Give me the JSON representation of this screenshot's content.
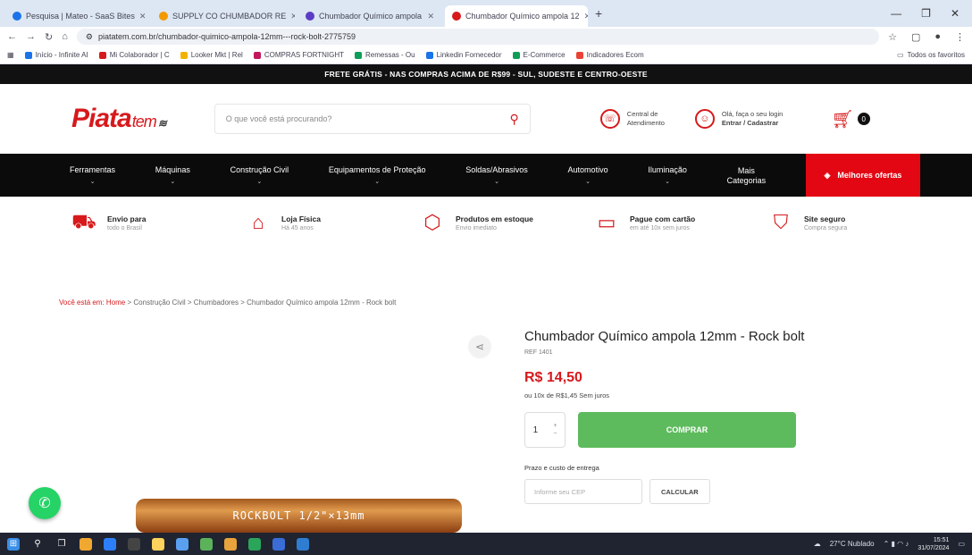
{
  "browser": {
    "tabs": [
      {
        "label": "Pesquisa | Mateo - SaaS Bites",
        "color": "#1a73e8"
      },
      {
        "label": "SUPPLY CO CHUMBADOR RE",
        "color": "#f29900"
      },
      {
        "label": "Chumbador Químico ampola",
        "color": "#5b3cc4"
      },
      {
        "label": "Chumbador Químico ampola 12",
        "color": "#d7191c"
      }
    ],
    "new_tab": "+",
    "url": "piatatem.com.br/chumbador-quimico-ampola-12mm---rock-bolt-2775759",
    "bookmarks": [
      {
        "label": "Início - Infinite AI",
        "color": "#1a73e8"
      },
      {
        "label": "Mi Colaborador | C",
        "color": "#d7191c"
      },
      {
        "label": "Looker Mkt | Rel",
        "color": "#f2b300"
      },
      {
        "label": "COMPRAS FORTNIGHT",
        "color": "#c2185b"
      },
      {
        "label": "Remessas - Ou",
        "color": "#0f9d58"
      },
      {
        "label": "Linkedin Fornecedor",
        "color": "#1a73e8"
      },
      {
        "label": "E-Commerce",
        "color": "#0f9d58"
      },
      {
        "label": "Indicadores Ecom",
        "color": "#ea4335"
      }
    ],
    "bookmarks_right": "Todos os favoritos"
  },
  "promo_bar": "FRETE GRÁTIS - NAS COMPRAS ACIMA DE R$99 - SUL, SUDESTE E CENTRO-OESTE",
  "header": {
    "logo_main": "Piata",
    "logo_sub": "tem",
    "search_placeholder": "O que você está procurando?",
    "service": {
      "line1": "Central de",
      "line2": "Atendimento"
    },
    "account": {
      "line1": "Olá, faça o seu login",
      "line2": "Entrar / Cadastrar"
    },
    "cart_count": "0"
  },
  "nav": {
    "items": [
      "Ferramentas",
      "Máquinas",
      "Construção Civil",
      "Equipamentos de Proteção",
      "Soldas/Abrasivos",
      "Automotivo",
      "Iluminação"
    ],
    "more": {
      "line1": "Mais",
      "line2": "Categorias"
    },
    "offers": "Melhores ofertas"
  },
  "benefits": [
    {
      "title": "Envio para",
      "subtitle": "todo o Brasil",
      "icon": "truck-icon"
    },
    {
      "title": "Loja Física",
      "subtitle": "Há 45 anos",
      "icon": "store-icon"
    },
    {
      "title": "Produtos em estoque",
      "subtitle": "Envio imediato",
      "icon": "box-icon"
    },
    {
      "title": "Pague com cartão",
      "subtitle": "em até 10x sem juros",
      "icon": "card-icon"
    },
    {
      "title": "Site seguro",
      "subtitle": "Compra segura",
      "icon": "shield-icon"
    }
  ],
  "breadcrumb": {
    "home": "Você está em: Home",
    "trail": "> Construção Civil > Chumbadores > Chumbador Químico ampola 12mm - Rock bolt"
  },
  "product": {
    "title": "Chumbador Químico ampola 12mm - Rock bolt",
    "sku": "REF 1401",
    "price": "R$ 14,50",
    "installment": "ou 10x de R$1,45 Sem juros",
    "qty": "1",
    "buy_label": "COMPRAR",
    "shipping_label": "Prazo e custo de entrega",
    "cep_placeholder": "Informe seu CEP",
    "calc_label": "CALCULAR",
    "image_text": "ROCKBOLT 1/2\"×13mm"
  },
  "taskbar": {
    "weather": "27°C Nublado",
    "time": "15:51",
    "date": "31/07/2024"
  }
}
